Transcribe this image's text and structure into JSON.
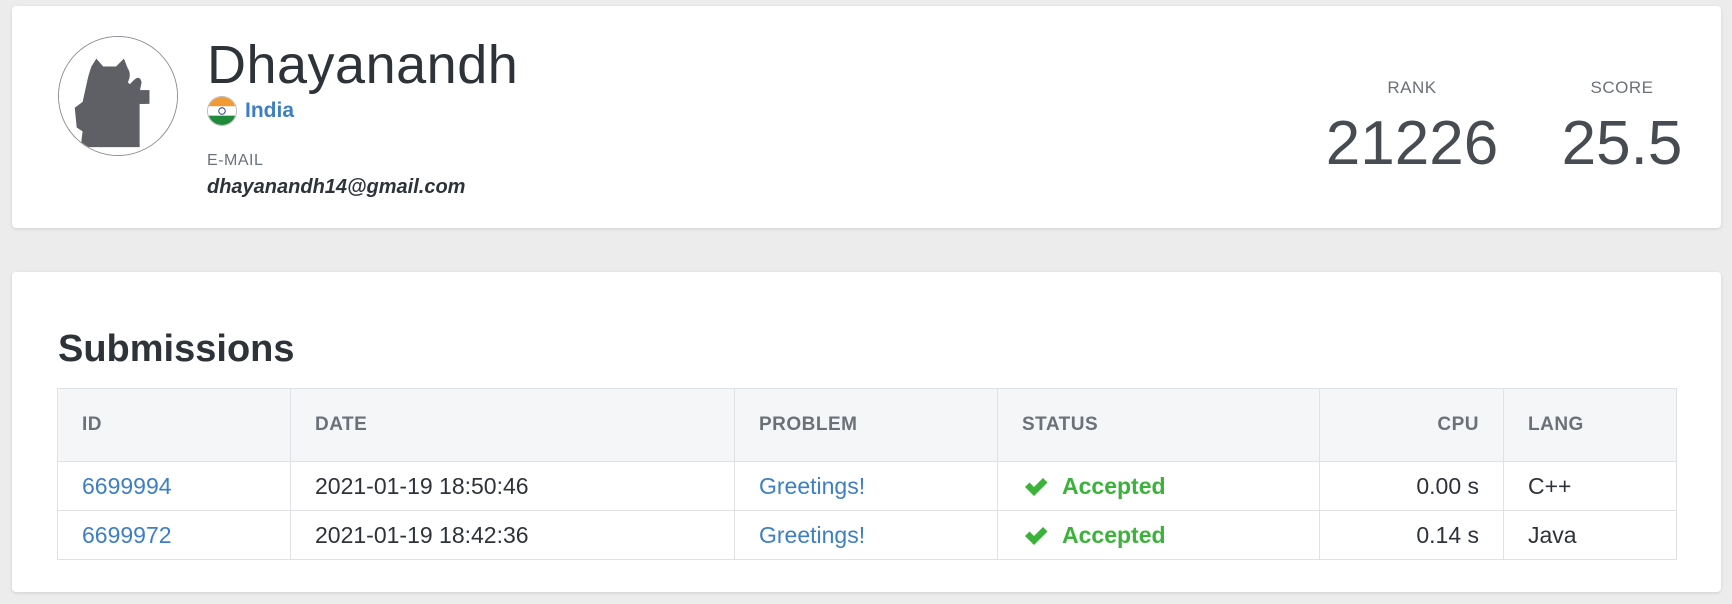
{
  "profile": {
    "name": "Dhayanandh",
    "country": "India",
    "email_label": "E-MAIL",
    "email": "dhayanandh14@gmail.com",
    "rank_label": "RANK",
    "rank": "21226",
    "score_label": "SCORE",
    "score": "25.5",
    "avatar_icon": "cat-avatar-icon",
    "flag_icon": "india-flag-icon"
  },
  "submissions": {
    "title": "Submissions",
    "columns": {
      "id": "ID",
      "date": "DATE",
      "problem": "PROBLEM",
      "status": "STATUS",
      "cpu": "CPU",
      "lang": "LANG"
    },
    "rows": [
      {
        "id": "6699994",
        "date": "2021-01-19 18:50:46",
        "problem": "Greetings!",
        "status": "Accepted",
        "cpu": "0.00 s",
        "lang": "C++"
      },
      {
        "id": "6699972",
        "date": "2021-01-19 18:42:36",
        "problem": "Greetings!",
        "status": "Accepted",
        "cpu": "0.14 s",
        "lang": "Java"
      }
    ]
  },
  "colors": {
    "link": "#3d7fc2",
    "accepted": "#3bb33b",
    "background": "#ececec"
  }
}
